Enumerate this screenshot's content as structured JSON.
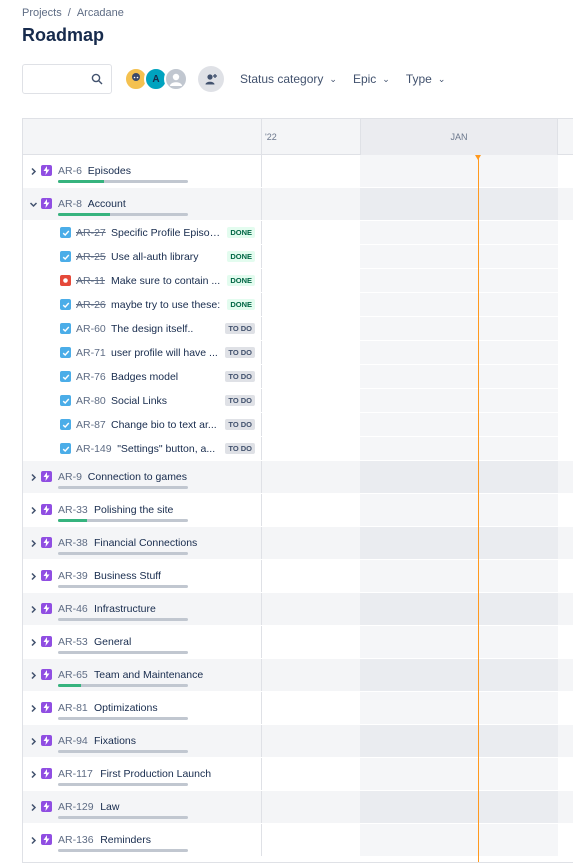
{
  "breadcrumb": {
    "projects": "Projects",
    "separator": "/",
    "project": "Arcadane"
  },
  "page_title": "Roadmap",
  "search": {
    "placeholder": ""
  },
  "avatars": [
    {
      "initial": "",
      "color": "#f4c150"
    },
    {
      "initial": "A",
      "color": "#00a3bf"
    },
    {
      "initial": "",
      "color": "#c1c7d0"
    }
  ],
  "filters": {
    "status_category": "Status category",
    "epic": "Epic",
    "type": "Type"
  },
  "timeline": {
    "month_prev": "'22",
    "month_current": "JAN"
  },
  "colors": {
    "epic": "#904ee2",
    "task": "#4bade8",
    "bug": "#e5493a",
    "progress_done": "#36b37e",
    "today": "#ff991f"
  },
  "epics": [
    {
      "key": "AR-6",
      "summary": "Episodes",
      "progress": 0.35,
      "expanded": false
    },
    {
      "key": "AR-8",
      "summary": "Account",
      "progress": 0.4,
      "expanded": true,
      "children": [
        {
          "key": "AR-27",
          "summary": "Specific Profile Episodes",
          "type": "task",
          "status": "DONE",
          "done": true
        },
        {
          "key": "AR-25",
          "summary": "Use all-auth library",
          "type": "task",
          "status": "DONE",
          "done": true
        },
        {
          "key": "AR-11",
          "summary": "Make sure to contain ...",
          "type": "bug",
          "status": "DONE",
          "done": true
        },
        {
          "key": "AR-26",
          "summary": "maybe try to use these:",
          "type": "task",
          "status": "DONE",
          "done": true
        },
        {
          "key": "AR-60",
          "summary": "The design itself..",
          "type": "task",
          "status": "TO DO",
          "done": false
        },
        {
          "key": "AR-71",
          "summary": "user profile will have ...",
          "type": "task",
          "status": "TO DO",
          "done": false
        },
        {
          "key": "AR-76",
          "summary": "Badges model",
          "type": "task",
          "status": "TO DO",
          "done": false
        },
        {
          "key": "AR-80",
          "summary": "Social Links",
          "type": "task",
          "status": "TO DO",
          "done": false
        },
        {
          "key": "AR-87",
          "summary": "Change bio to text ar...",
          "type": "task",
          "status": "TO DO",
          "done": false
        },
        {
          "key": "AR-149",
          "summary": "\"Settings\" button, a...",
          "type": "task",
          "status": "TO DO",
          "done": false
        }
      ]
    },
    {
      "key": "AR-9",
      "summary": "Connection to games",
      "progress": 0,
      "expanded": false
    },
    {
      "key": "AR-33",
      "summary": "Polishing the site",
      "progress": 0.22,
      "expanded": false
    },
    {
      "key": "AR-38",
      "summary": "Financial Connections",
      "progress": 0,
      "expanded": false
    },
    {
      "key": "AR-39",
      "summary": "Business Stuff",
      "progress": 0,
      "expanded": false
    },
    {
      "key": "AR-46",
      "summary": "Infrastructure",
      "progress": 0,
      "expanded": false
    },
    {
      "key": "AR-53",
      "summary": "General",
      "progress": 0,
      "expanded": false
    },
    {
      "key": "AR-65",
      "summary": "Team and Maintenance",
      "progress": 0.18,
      "expanded": false
    },
    {
      "key": "AR-81",
      "summary": "Optimizations",
      "progress": 0,
      "expanded": false
    },
    {
      "key": "AR-94",
      "summary": "Fixations",
      "progress": 0,
      "expanded": false
    },
    {
      "key": "AR-117",
      "summary": "First Production Launch",
      "progress": 0,
      "expanded": false
    },
    {
      "key": "AR-129",
      "summary": "Law",
      "progress": 0,
      "expanded": false
    },
    {
      "key": "AR-136",
      "summary": "Reminders",
      "progress": 0,
      "expanded": false
    }
  ]
}
